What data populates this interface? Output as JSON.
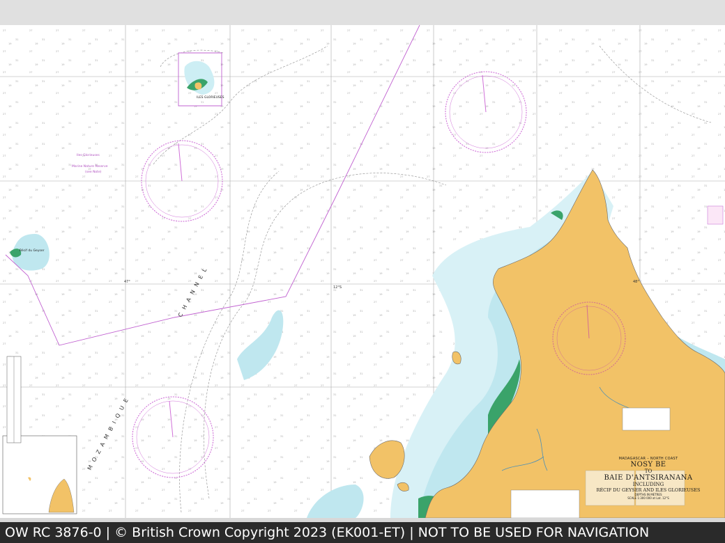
{
  "footer": {
    "text": "OW RC 3876-0 | © British Crown Copyright 2023 (EK001-ET) | NOT TO BE USED FOR NAVIGATION"
  },
  "chart": {
    "region": "MADAGASCAR – NORTH COAST",
    "title_line1": "NOSY BE",
    "title_to": "TO",
    "title_line2": "BAIE D'ANTSIRANANA",
    "including": "INCLUDING",
    "title_line3": "RÉCIF DU GEYSER AND ILES GLORIEUSES",
    "depths": "DEPTHS IN METRES",
    "scale": "SCALE 1:300 000 at Lat. 12°S",
    "channel_name": "MOZAMBIQUE CHANNEL"
  },
  "places": {
    "glorieuses": "ILES GLORIEUSES",
    "geyser": "Récif du Geyser",
    "reserve": "Marine Nature Reserve",
    "iles_glorieuses_small": "Iles Glorieuses",
    "zone_note": "(see Note)"
  },
  "graticule": {
    "lon_labels": [
      "47°",
      "48°"
    ],
    "lat_label": "12°S"
  },
  "colors": {
    "land": "#f2c267",
    "shallow": "#bfe7ef",
    "deeper": "#d8f1f6",
    "intertidal": "#3aa36a",
    "compass": "#d070d8",
    "boundary": "#c060d0",
    "grid": "#9a9a9a",
    "bar": "#2a2a2a"
  }
}
